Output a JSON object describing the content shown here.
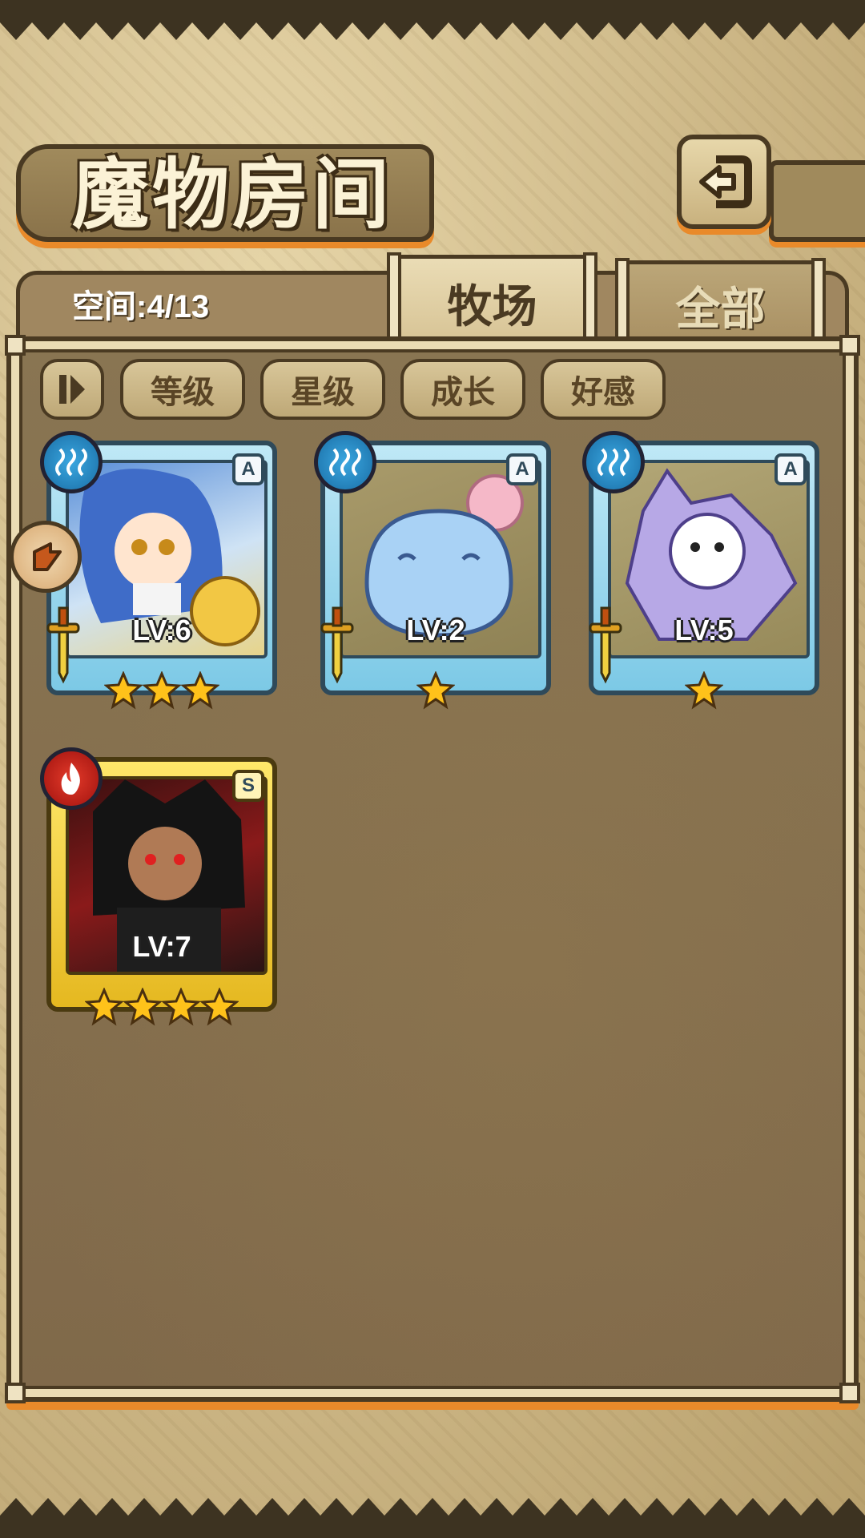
{
  "header": {
    "title": "魔物房间",
    "capacity_label": "空间:4/13"
  },
  "tabs": [
    {
      "label": "牧场",
      "active": true
    },
    {
      "label": "全部",
      "active": false
    }
  ],
  "sort_buttons": [
    "等级",
    "星级",
    "成长",
    "好感"
  ],
  "monsters": [
    {
      "level": "LV:6",
      "rank": "A",
      "element": "water",
      "stars": 3
    },
    {
      "level": "LV:2",
      "rank": "A",
      "element": "water",
      "stars": 1
    },
    {
      "level": "LV:5",
      "rank": "A",
      "element": "water",
      "stars": 1
    },
    {
      "level": "LV:7",
      "rank": "S",
      "element": "fire",
      "stars": 4
    }
  ],
  "colors": {
    "accent_orange": "#e98a2a",
    "frame_dark": "#4a3a22",
    "card_blue": "#7cc9e6",
    "card_gold": "#e5b820"
  }
}
